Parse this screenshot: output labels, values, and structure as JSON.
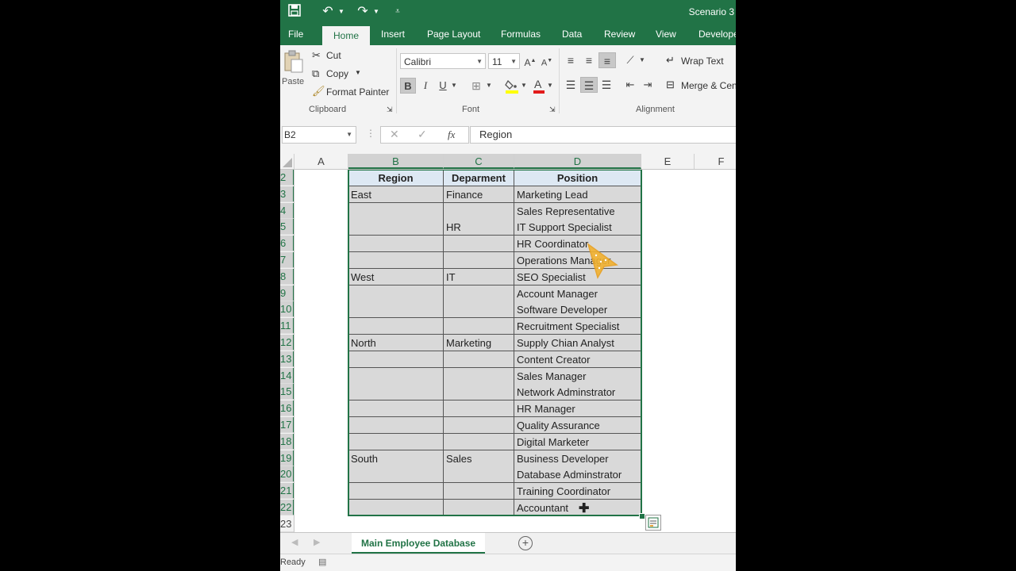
{
  "title_bar": {
    "title": "Scenario 3"
  },
  "ribbon_tabs": [
    "File",
    "Home",
    "Insert",
    "Page Layout",
    "Formulas",
    "Data",
    "Review",
    "View",
    "Develope"
  ],
  "ribbon": {
    "clipboard": {
      "paste": "Paste",
      "cut": "Cut",
      "copy": "Copy",
      "format_painter": "Format Painter",
      "label": "Clipboard"
    },
    "font": {
      "font_name": "Calibri",
      "font_size": "11",
      "bold": "B",
      "italic": "I",
      "underline": "U",
      "label": "Font"
    },
    "alignment": {
      "wrap_text": "Wrap Text",
      "merge_center": "Merge & Cen",
      "label": "Alignment"
    }
  },
  "formula_bar": {
    "name_box": "B2",
    "formula": "Region"
  },
  "columns": [
    "A",
    "B",
    "C",
    "D",
    "E",
    "F"
  ],
  "rows": [
    "2",
    "3",
    "4",
    "5",
    "6",
    "7",
    "8",
    "9",
    "10",
    "11",
    "12",
    "13",
    "14",
    "15",
    "16",
    "17",
    "18",
    "19",
    "20",
    "21",
    "22",
    "23"
  ],
  "table": {
    "headers": [
      "Region",
      "Deparment",
      "Position"
    ],
    "rows": [
      [
        "East",
        "Finance",
        "Marketing Lead"
      ],
      [
        "",
        "",
        "Sales Representative"
      ],
      [
        "",
        "HR",
        "IT Support Specialist"
      ],
      [
        "",
        "",
        "HR Coordinator"
      ],
      [
        "",
        "",
        "Operations Manager"
      ],
      [
        "West",
        "IT",
        "SEO Specialist"
      ],
      [
        "",
        "",
        "Account Manager"
      ],
      [
        "",
        "",
        "Software Developer"
      ],
      [
        "",
        "",
        "Recruitment Specialist"
      ],
      [
        "North",
        "Marketing",
        "Supply Chian Analyst"
      ],
      [
        "",
        "",
        "Content Creator"
      ],
      [
        "",
        "",
        "Sales Manager"
      ],
      [
        "",
        "",
        "Network Adminstrator"
      ],
      [
        "",
        "",
        "HR Manager"
      ],
      [
        "",
        "",
        "Quality Assurance"
      ],
      [
        "",
        "",
        "Digital Marketer"
      ],
      [
        "South",
        "Sales",
        "Business Developer"
      ],
      [
        "",
        "",
        "Database Adminstrator"
      ],
      [
        "",
        "",
        "Training Coordinator"
      ],
      [
        "",
        "",
        "Accountant"
      ]
    ]
  },
  "sheet_tabs": {
    "active": "Main Employee Database"
  },
  "status": {
    "text": "Ready"
  },
  "colors": {
    "excel_green": "#217346",
    "cell_fill": "#d9d9d9",
    "header_fill": "#dde8f3"
  }
}
